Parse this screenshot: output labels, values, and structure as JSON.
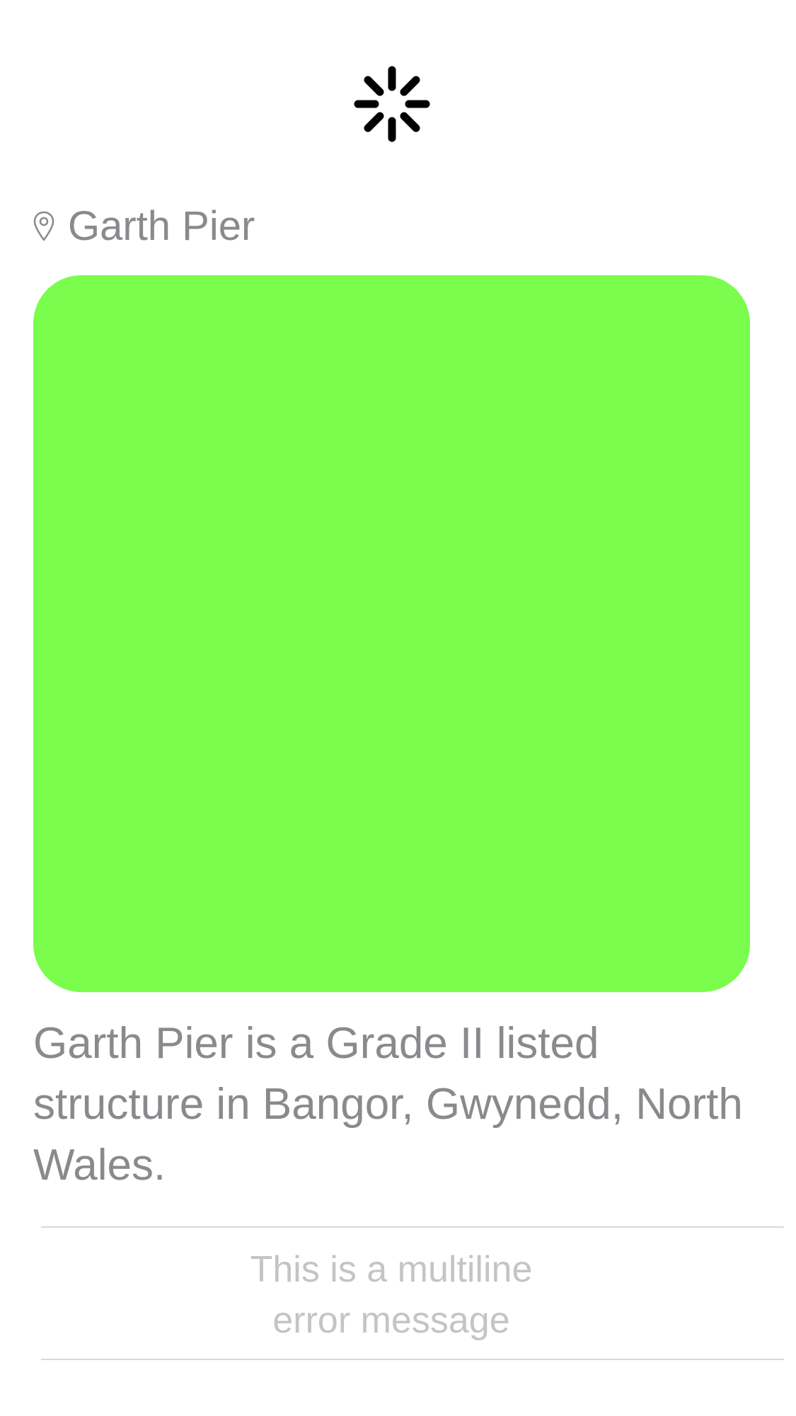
{
  "loading": {
    "icon": "activity-spinner-icon"
  },
  "location": {
    "icon": "location-pin-icon",
    "name": "Garth Pier"
  },
  "preview": {
    "color": "#7AFD4D"
  },
  "description": "Garth Pier is a Grade II listed structure in Bangor, Gwynedd, North Wales.",
  "error": {
    "line1": "This is a multiline",
    "line2": "error message"
  }
}
